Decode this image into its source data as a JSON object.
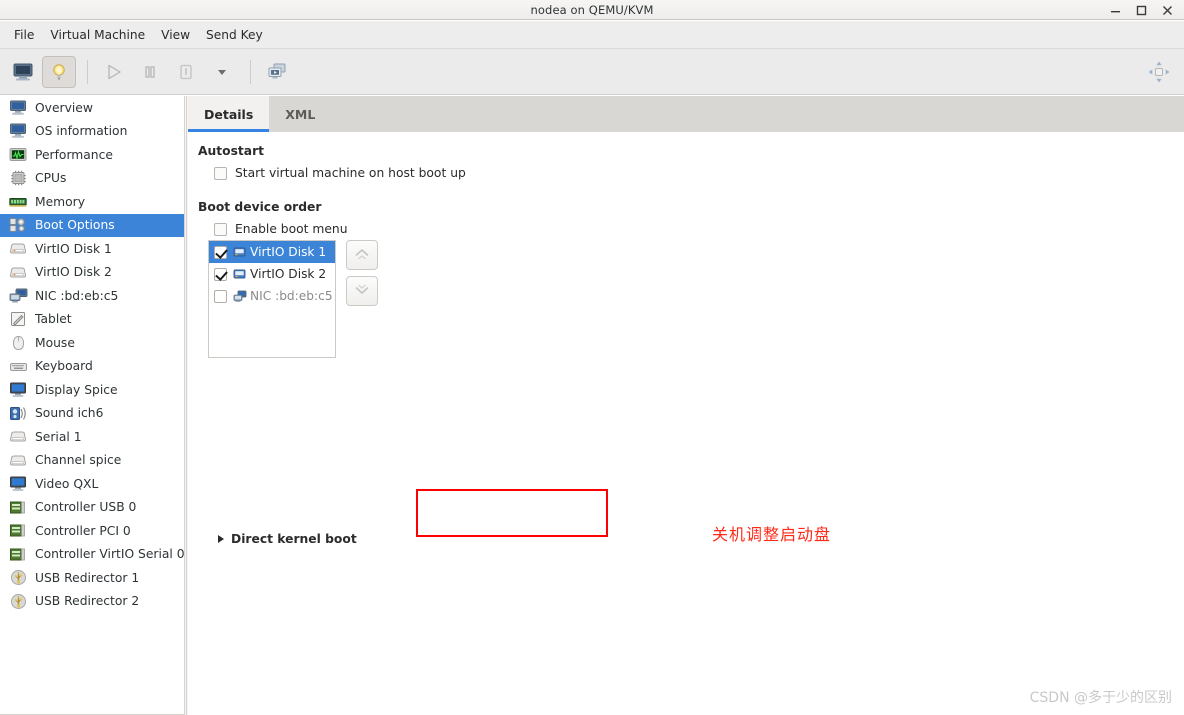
{
  "window": {
    "title": "nodea on QEMU/KVM",
    "controls": [
      {
        "name": "minimize",
        "glyph": "–"
      },
      {
        "name": "maximize",
        "glyph": "□"
      },
      {
        "name": "close",
        "glyph": "✕"
      }
    ]
  },
  "menubar": {
    "items": [
      "File",
      "Virtual Machine",
      "View",
      "Send Key"
    ]
  },
  "toolbar": {
    "buttons": [
      {
        "name": "console-view-icon",
        "label": "Console view"
      },
      {
        "name": "details-view-icon",
        "label": "Show virtual hardware details"
      },
      {
        "name": "run-icon",
        "label": "Run"
      },
      {
        "name": "pause-icon",
        "label": "Pause"
      },
      {
        "name": "shutdown-icon",
        "label": "Shut down"
      },
      {
        "name": "shutdown-menu-arrow-icon",
        "label": "Shutdown options"
      },
      {
        "name": "snapshots-icon",
        "label": "Manage snapshots"
      }
    ],
    "fullscreen_label": "Fullscreen"
  },
  "sidebar": {
    "items": [
      {
        "label": "Overview",
        "icon": "monitor-icon",
        "selected": false
      },
      {
        "label": "OS information",
        "icon": "monitor-icon",
        "selected": false
      },
      {
        "label": "Performance",
        "icon": "performance-graph-icon",
        "selected": false
      },
      {
        "label": "CPUs",
        "icon": "cpu-chip-icon",
        "selected": false
      },
      {
        "label": "Memory",
        "icon": "memory-stick-icon",
        "selected": false
      },
      {
        "label": "Boot Options",
        "icon": "boot-options-icon",
        "selected": true
      },
      {
        "label": "VirtIO Disk 1",
        "icon": "disk-icon",
        "selected": false
      },
      {
        "label": "VirtIO Disk 2",
        "icon": "disk-icon",
        "selected": false
      },
      {
        "label": "NIC :bd:eb:c5",
        "icon": "network-icon",
        "selected": false
      },
      {
        "label": "Tablet",
        "icon": "tablet-pen-icon",
        "selected": false
      },
      {
        "label": "Mouse",
        "icon": "mouse-icon",
        "selected": false
      },
      {
        "label": "Keyboard",
        "icon": "keyboard-icon",
        "selected": false
      },
      {
        "label": "Display Spice",
        "icon": "display-icon",
        "selected": false
      },
      {
        "label": "Sound ich6",
        "icon": "sound-icon",
        "selected": false
      },
      {
        "label": "Serial 1",
        "icon": "serial-icon",
        "selected": false
      },
      {
        "label": "Channel spice",
        "icon": "serial-icon",
        "selected": false
      },
      {
        "label": "Video QXL",
        "icon": "display-icon",
        "selected": false
      },
      {
        "label": "Controller USB 0",
        "icon": "controller-card-icon",
        "selected": false
      },
      {
        "label": "Controller PCI 0",
        "icon": "controller-card-icon",
        "selected": false
      },
      {
        "label": "Controller VirtIO Serial 0",
        "icon": "controller-card-icon",
        "selected": false
      },
      {
        "label": "USB Redirector 1",
        "icon": "usb-icon",
        "selected": false
      },
      {
        "label": "USB Redirector 2",
        "icon": "usb-icon",
        "selected": false
      }
    ]
  },
  "main": {
    "tabs": [
      {
        "label": "Details",
        "active": true
      },
      {
        "label": "XML",
        "active": false
      }
    ],
    "autostart": {
      "heading": "Autostart",
      "checkbox_label": "Start virtual machine on host boot up",
      "checked": false
    },
    "boot_device_order": {
      "heading": "Boot device order",
      "enable_boot_menu_label": "Enable boot menu",
      "enable_boot_menu_checked": false,
      "devices": [
        {
          "label": "VirtIO Disk 1",
          "checked": true,
          "selected": true,
          "enabled": true,
          "icon": "disk-small-icon"
        },
        {
          "label": "VirtIO Disk 2",
          "checked": true,
          "selected": false,
          "enabled": true,
          "icon": "disk-small-icon"
        },
        {
          "label": "NIC :bd:eb:c5",
          "checked": false,
          "selected": false,
          "enabled": false,
          "icon": "network-small-icon"
        }
      ],
      "move_up_label": "Move device up",
      "move_down_label": "Move device down"
    },
    "direct_kernel_boot": {
      "label": "Direct kernel boot",
      "expanded": false
    }
  },
  "annotations": {
    "red_note": "关机调整启动盘",
    "red_note_color": "#ff2a18",
    "highlight_box_color": "#ff0000"
  },
  "watermark": {
    "text": "CSDN @多于少的区别"
  },
  "colors": {
    "accent": "#3584e4",
    "selection": "#3b84d8",
    "window_bg": "#f6f5f4",
    "panel_bg": "#ffffff"
  }
}
